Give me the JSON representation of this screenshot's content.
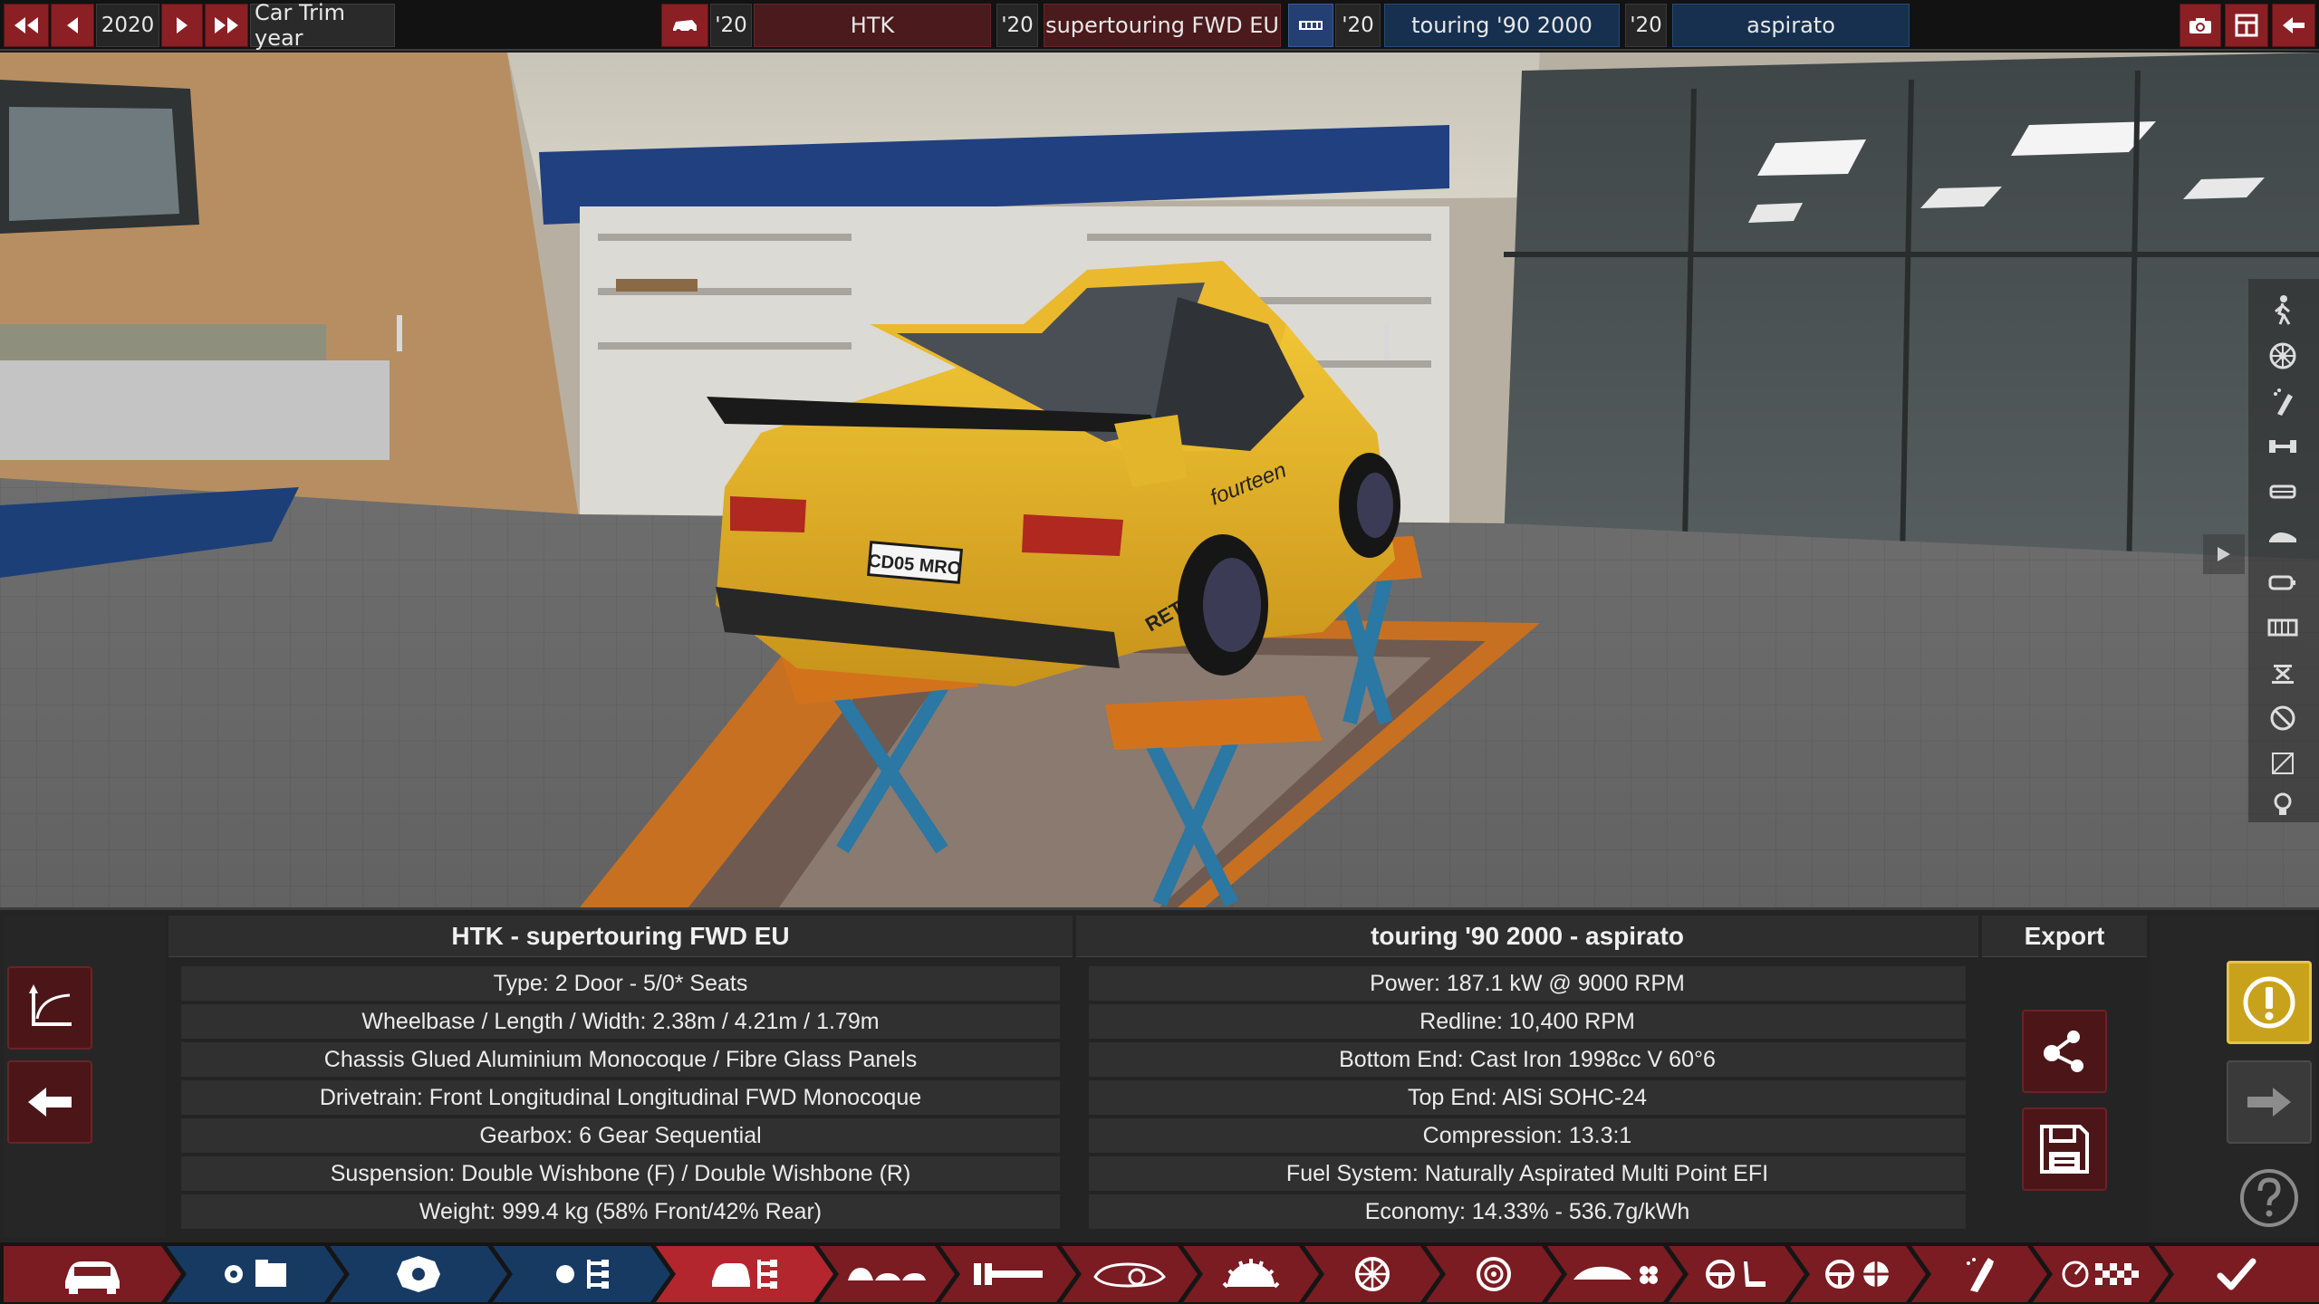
{
  "topbar": {
    "year": "2020",
    "trim_year_label": "Car Trim year",
    "model_year": "'20",
    "model_name": "HTK",
    "trim_year": "'20",
    "trim_name": "supertouring FWD EU",
    "engine_family_year": "'20",
    "engine_family_name": "touring '90 2000",
    "engine_variant_year": "'20",
    "engine_variant_name": "aspirato",
    "icons": {
      "first": "skip-back-icon",
      "prev": "previous-icon",
      "next": "next-icon",
      "last": "skip-forward-icon",
      "car": "car-model-icon",
      "engine": "engine-block-icon",
      "camera": "camera-icon",
      "layout": "layout-icon",
      "back": "back-arrow-icon"
    }
  },
  "scene": {
    "license_plate": "CD05 MRO",
    "sponsor_text": "fourteen",
    "side_text": "RETECH"
  },
  "side_rail": {
    "icons": [
      "pedestrian-icon",
      "wheel-icon",
      "spray-icon",
      "axle-icon",
      "seat-icon",
      "car-side-icon",
      "fuel-icon",
      "grille-icon",
      "lift-icon",
      "no-entry-icon",
      "square-icon",
      "bulb-icon"
    ],
    "toggle_icon": "play-icon"
  },
  "car_panel": {
    "title": "HTK - supertouring FWD EU",
    "rows": [
      "Type: 2 Door - 5/0* Seats",
      "Wheelbase / Length / Width: 2.38m / 4.21m / 1.79m",
      "Chassis Glued Aluminium Monocoque / Fibre Glass Panels",
      "Drivetrain: Front Longitudinal Longitudinal FWD Monocoque",
      "Gearbox: 6 Gear Sequential",
      "Suspension: Double Wishbone (F) / Double Wishbone (R)",
      "Weight: 999.4 kg (58% Front/42% Rear)"
    ]
  },
  "engine_panel": {
    "title": "touring '90 2000 - aspirato",
    "rows": [
      "Power: 187.1 kW @ 9000 RPM",
      "Redline:  10,400 RPM",
      "Bottom End: Cast Iron 1998cc V 60°6",
      "Top End: AlSi SOHC-24",
      "Compression: 13.3:1",
      "Fuel System: Naturally Aspirated Multi Point EFI",
      "Economy: 14.33% - 536.7g/kWh"
    ]
  },
  "export_panel": {
    "title": "Export",
    "share_icon": "share-icon",
    "save_icon": "save-icon"
  },
  "left_controls": {
    "graph_icon": "graph-axes-icon",
    "back_icon": "back-arrow-icon"
  },
  "right_controls": {
    "warning_icon": "warning-icon",
    "forward_icon": "forward-arrow-icon",
    "help_icon": "help-icon"
  },
  "tabs": [
    {
      "icon": "car-front-icon",
      "style": "red"
    },
    {
      "icon": "engine-folder-icon",
      "style": "blue"
    },
    {
      "icon": "engine-icon",
      "style": "blue"
    },
    {
      "icon": "engine-tree-icon",
      "style": "blue"
    },
    {
      "icon": "car-tree-icon",
      "style": "red-active"
    },
    {
      "icon": "car-lineup-icon",
      "style": "red"
    },
    {
      "icon": "chassis-frame-icon",
      "style": "red"
    },
    {
      "icon": "car-body-icon",
      "style": "red"
    },
    {
      "icon": "gear-half-icon",
      "style": "red"
    },
    {
      "icon": "wheel-spokes-icon",
      "style": "red"
    },
    {
      "icon": "brake-disc-icon",
      "style": "red"
    },
    {
      "icon": "aero-icon",
      "style": "red"
    },
    {
      "icon": "steering-seat-icon",
      "style": "red"
    },
    {
      "icon": "steering-test-icon",
      "style": "red"
    },
    {
      "icon": "paint-spray-icon",
      "style": "red"
    },
    {
      "icon": "gauge-flag-icon",
      "style": "red"
    },
    {
      "icon": "checkmark-icon",
      "style": "red"
    }
  ],
  "colors": {
    "accent_red": "#8a1f24",
    "accent_blue": "#17304f",
    "warning_yellow": "#c8a21b",
    "car_yellow": "#e8b623",
    "lift_orange": "#d2731c",
    "lift_blue": "#2a78a3"
  }
}
